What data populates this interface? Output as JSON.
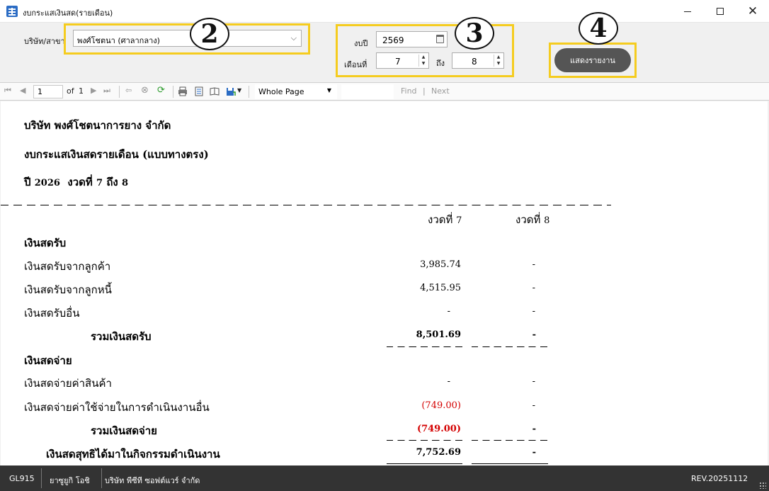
{
  "window": {
    "title": "งบกระแสเงินสด(รายเดือน)",
    "minimize_icon": "minimize-icon",
    "maximize_icon": "maximize-icon",
    "close_icon": "close-icon"
  },
  "params": {
    "company_label": "บริษัท/สาขา",
    "company_value": "พงศ์โชตนา (ศาลากลาง)",
    "year_label": "งบปี",
    "year_value": "2569",
    "month_label": "เดือนที่",
    "month_from": "7",
    "to_label": "ถึง",
    "month_to": "8",
    "run_button": "แสดงรายงาน",
    "accent_color": "#f5cc1f",
    "callouts": [
      "2",
      "3",
      "4"
    ]
  },
  "toolbar": {
    "page_current": "1",
    "page_of": "of",
    "page_total": "1",
    "zoom": "Whole Page",
    "find_label": "Find",
    "separator": "|",
    "next_label": "Next",
    "icons": [
      "first-page-icon",
      "prev-page-icon",
      "next-page-icon",
      "last-page-icon",
      "back-icon",
      "stop-icon",
      "refresh-icon",
      "print-icon",
      "print-layout-icon",
      "page-setup-icon",
      "export-icon"
    ]
  },
  "report": {
    "company": "บริษัท พงศ์โชตนาการยาง จำกัด",
    "title": "งบกระแสเงินสดรายเดือน (แบบทางตรง)",
    "period_prefix": "ปี",
    "period_year": "2026",
    "period_mid": "งวดที่",
    "period_from": "7",
    "period_to_word": "ถึง",
    "period_to": "8",
    "columns": [
      {
        "label": "งวดที่",
        "num": "7"
      },
      {
        "label": "งวดที่",
        "num": "8"
      }
    ],
    "receipts_header": "เงินสดรับ",
    "receipts": [
      {
        "label": "เงินสดรับจากลูกค้า",
        "p7": "3,985.74",
        "p8": "-"
      },
      {
        "label": "เงินสดรับจากลูกหนี้",
        "p7": "4,515.95",
        "p8": "-"
      },
      {
        "label": "เงินสดรับอื่น",
        "p7": "-",
        "p8": "-"
      }
    ],
    "receipts_total": {
      "label": "รวมเงินสดรับ",
      "p7": "8,501.69",
      "p8": "-"
    },
    "payments_header": "เงินสดจ่าย",
    "payments": [
      {
        "label": "เงินสดจ่ายค่าสินค้า",
        "p7": "-",
        "p8": "-"
      },
      {
        "label": "เงินสดจ่ายค่าใช้จ่ายในการดำเนินงานอื่น",
        "p7": "(749.00)",
        "p8": "-"
      }
    ],
    "payments_total": {
      "label": "รวมเงินสดจ่าย",
      "p7": "(749.00)",
      "p8": "-"
    },
    "net_total": {
      "label": "เงินสดสุทธิได้มาในกิจกรรมดำเนินงาน",
      "p7": "7,752.69",
      "p8": "-"
    },
    "negative_color": "#d40000"
  },
  "status": {
    "code": "GL915",
    "user": "ยาซูยูกิ โอชิ",
    "company": "บริษัท พีซีที ซอฟต์แวร์ จำกัด",
    "revision": "REV.20251112"
  }
}
